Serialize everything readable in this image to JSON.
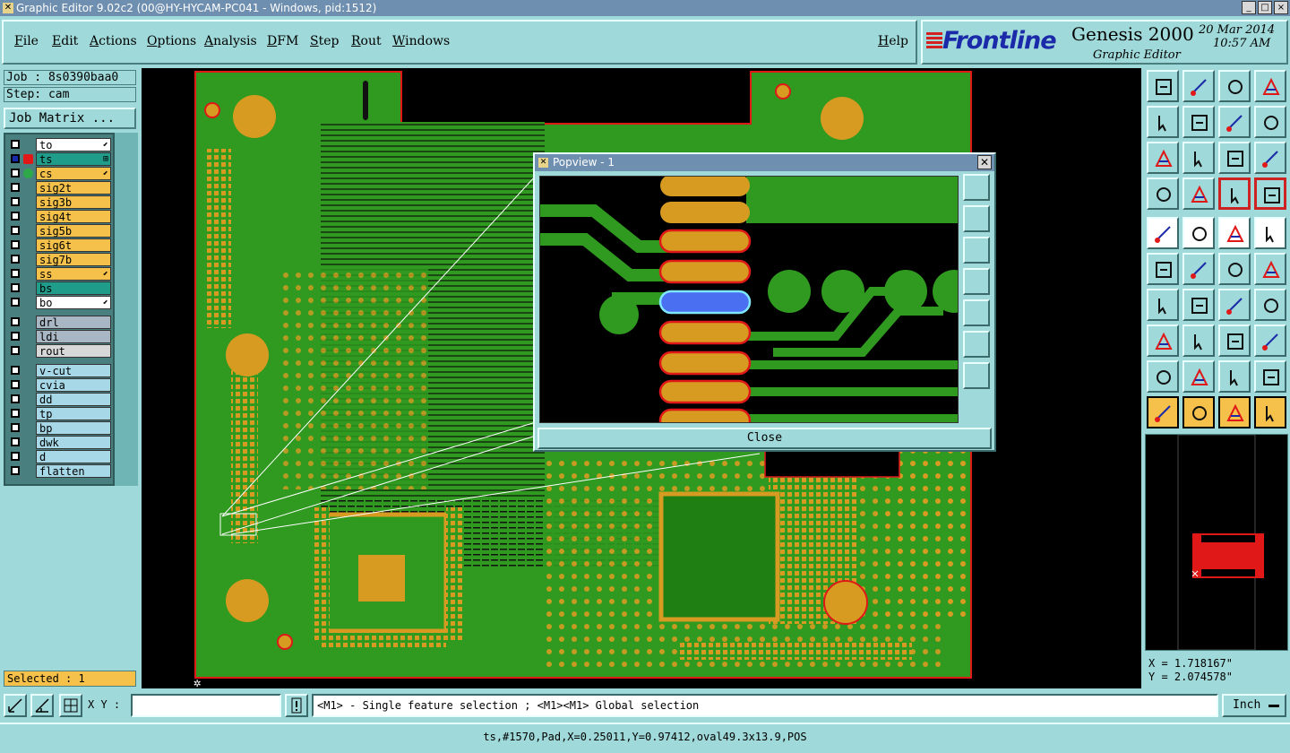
{
  "window": {
    "title": "Graphic Editor 9.02c2 (00@HY-HYCAM-PC041 - Windows, pid:1512)",
    "controls": [
      "_",
      "□",
      "×"
    ]
  },
  "menu": [
    "File",
    "Edit",
    "Actions",
    "Options",
    "Analysis",
    "DFM",
    "Step",
    "Rout",
    "Windows"
  ],
  "help": "Help",
  "brand": {
    "logo": "Frontline",
    "product": "Genesis 2000",
    "subtitle": "Graphic Editor",
    "date": "20 Mar 2014",
    "time": "10:57 AM"
  },
  "job": {
    "job_label": "Job : 8s0390baa0",
    "step_label": "Step: cam",
    "matrix_button": "Job Matrix ..."
  },
  "layers": [
    {
      "name": "to",
      "style": "white",
      "tag": "⬋"
    },
    {
      "name": "ts",
      "style": "teal",
      "tag": "⊞",
      "active": true
    },
    {
      "name": "cs",
      "style": "orange",
      "tag": "⬋",
      "dot": "#2fa84a"
    },
    {
      "name": "sig2t",
      "style": "orange"
    },
    {
      "name": "sig3b",
      "style": "orange"
    },
    {
      "name": "sig4t",
      "style": "orange"
    },
    {
      "name": "sig5b",
      "style": "orange"
    },
    {
      "name": "sig6t",
      "style": "orange"
    },
    {
      "name": "sig7b",
      "style": "orange"
    },
    {
      "name": "ss",
      "style": "orange",
      "tag": "⬋"
    },
    {
      "name": "bs",
      "style": "teal"
    },
    {
      "name": "bo",
      "style": "white",
      "tag": "⬋"
    },
    {
      "name": "drl",
      "style": "gray"
    },
    {
      "name": "ldi",
      "style": "gray"
    },
    {
      "name": "rout",
      "style": "lgray"
    },
    {
      "name": "v-cut",
      "style": "cyan"
    },
    {
      "name": "cvia",
      "style": "cyan"
    },
    {
      "name": "dd",
      "style": "cyan"
    },
    {
      "name": "tp",
      "style": "cyan"
    },
    {
      "name": "bp",
      "style": "cyan"
    },
    {
      "name": "dwk",
      "style": "cyan"
    },
    {
      "name": "d",
      "style": "cyan"
    },
    {
      "name": "flatten",
      "style": "cyan"
    }
  ],
  "selected": "Selected : 1",
  "popview": {
    "title": "Popview - 1",
    "close_label": "Close"
  },
  "coords": {
    "x": "X = 1.718167\"",
    "y": "Y = 2.074578\""
  },
  "bottom": {
    "xy_label": "X Y :",
    "xy_value": "",
    "message": "<M1> - Single feature selection ; <M1><M1> Global selection",
    "unit": "Inch"
  },
  "status": "ts,#1570,Pad,X=0.25011,Y=0.97412,oval49.3x13.9,POS",
  "colors": {
    "board_green": "#2f9a1f",
    "pad_orange": "#d79b22",
    "outline_red": "#e01818",
    "highlight_blue": "#4a6ff0",
    "panel_teal": "#9fd9d9"
  }
}
